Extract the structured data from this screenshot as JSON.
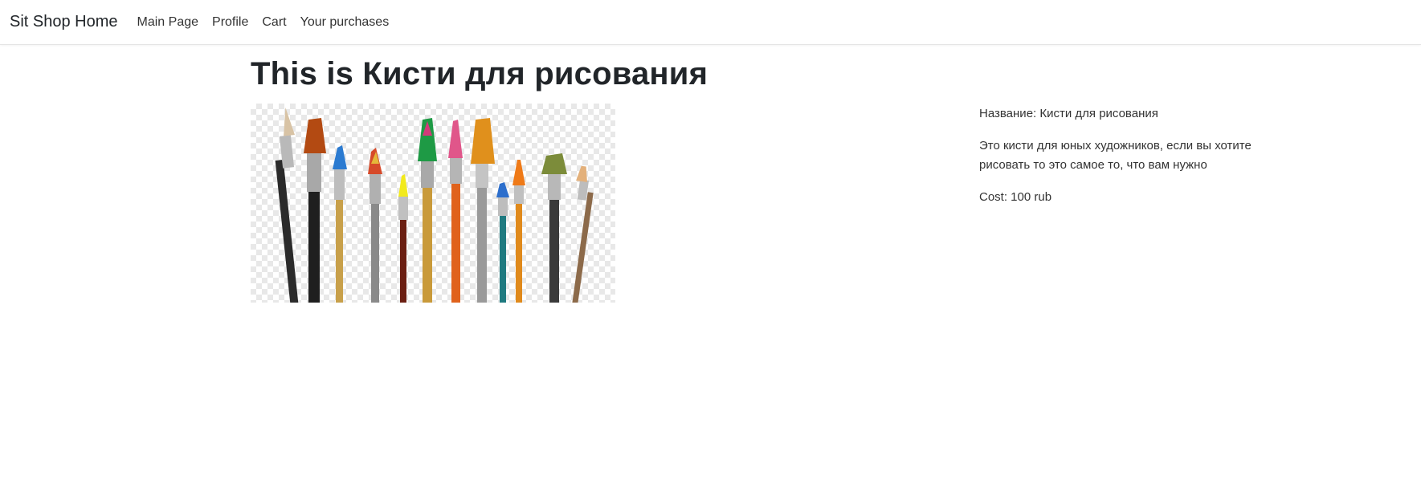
{
  "navbar": {
    "brand": "Sit Shop Home",
    "links": [
      "Main Page",
      "Profile",
      "Cart",
      "Your purchases"
    ]
  },
  "product": {
    "heading": "This is Кисти для рисования",
    "name_line": "Название: Кисти для рисования",
    "description": "Это кисти для юных художников, если вы хотите рисовать то это самое то, что вам нужно",
    "cost_line": "Cost: 100 rub",
    "image_icon": "paintbrushes-image"
  }
}
